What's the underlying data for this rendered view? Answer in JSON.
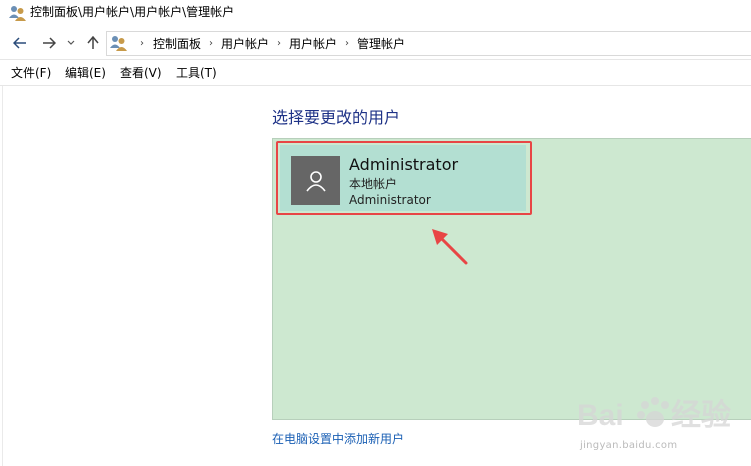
{
  "window": {
    "title": "控制面板\\用户帐户\\用户帐户\\管理帐户",
    "icon": "users-icon"
  },
  "navigation": {
    "back_icon": "arrow-left-icon",
    "forward_icon": "arrow-right-icon",
    "recent_icon": "chevron-down-icon",
    "up_icon": "arrow-up-icon",
    "breadcrumb": [
      "控制面板",
      "用户帐户",
      "用户帐户",
      "管理帐户"
    ]
  },
  "menu": {
    "items": [
      "文件(F)",
      "编辑(E)",
      "查看(V)",
      "工具(T)"
    ]
  },
  "main": {
    "heading": "选择要更改的用户",
    "users": [
      {
        "name": "Administrator",
        "type": "本地帐户",
        "role": "Administrator",
        "avatar_icon": "person-icon"
      }
    ],
    "add_user_link": "在电脑设置中添加新用户"
  },
  "watermark": {
    "text": "jingyan.baidu.com"
  },
  "colors": {
    "heading": "#1e3287",
    "user_area_bg": "#cde8d0",
    "user_tile_bg": "#b3dfd2",
    "avatar_bg": "#666666",
    "highlight": "#e84545",
    "link": "#1a5fb4"
  }
}
